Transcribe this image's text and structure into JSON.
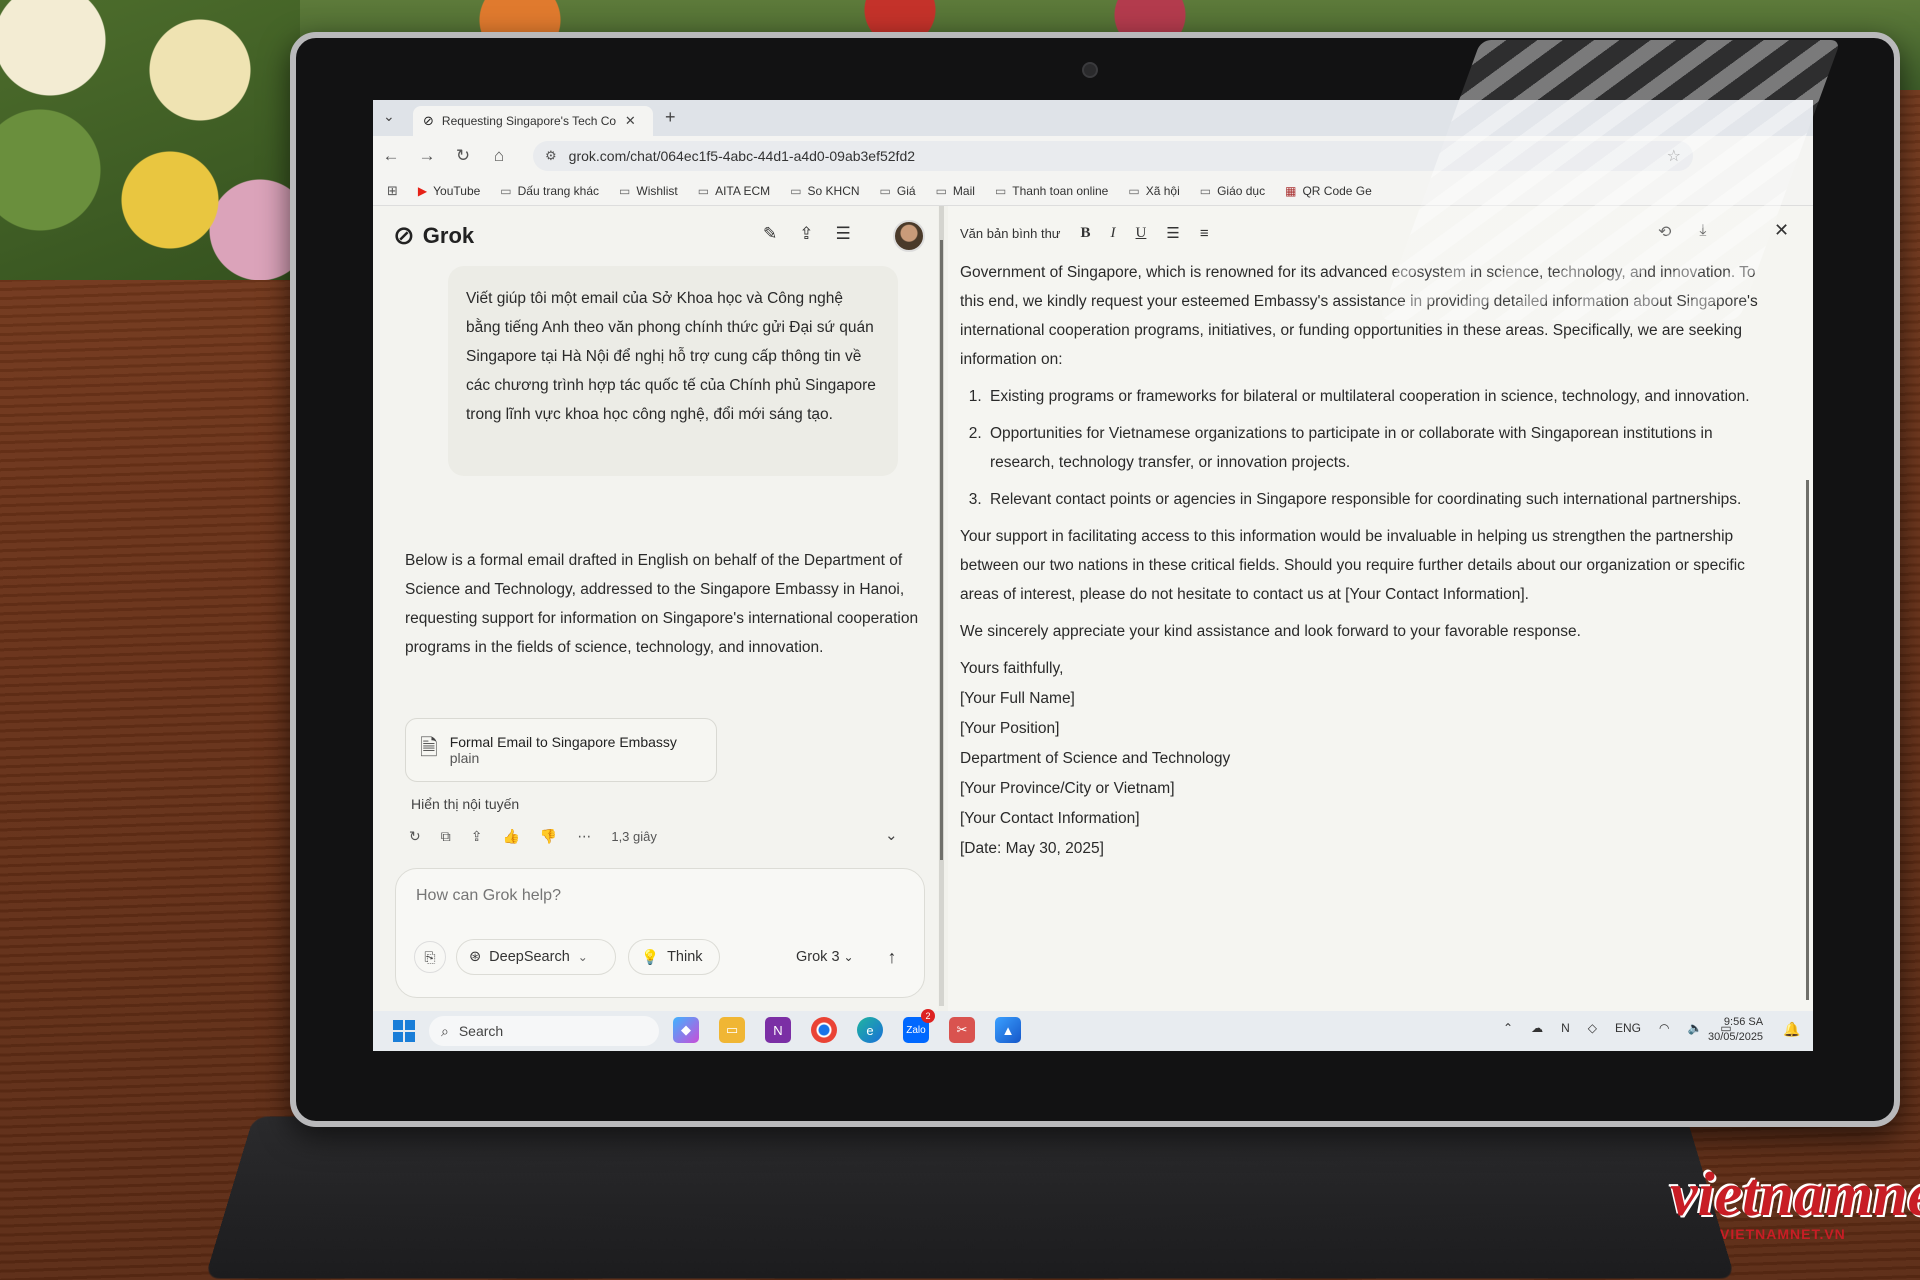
{
  "browser": {
    "tab_title": "Requesting Singapore's Tech Co",
    "url": "grok.com/chat/064ec1f5-4abc-44d1-a4d0-09ab3ef52fd2",
    "bookmarks": [
      "YouTube",
      "Dấu trang khác",
      "Wishlist",
      "AITA ECM",
      "So KHCN",
      "Giá",
      "Mail",
      "Thanh toan online",
      "Xã hội",
      "Giáo dục",
      "QR Code Ge"
    ]
  },
  "grok": {
    "brand": "Grok",
    "user_message": "Viết giúp tôi một email của Sở Khoa học và Công nghệ bằng tiếng Anh theo văn phong chính thức gửi Đại sứ quán Singapore tại Hà Nội để nghị hỗ trợ cung cấp thông tin về các chương trình hợp tác quốc tế của Chính phủ Singapore trong lĩnh vực khoa học công nghệ, đổi mới sáng tạo.",
    "assistant_message": "Below is a formal email drafted in English on behalf of the Department of Science and Technology, addressed to the Singapore Embassy in Hanoi, requesting support for information on Singapore's international cooperation programs in the fields of science, technology, and innovation.",
    "artifact_title": "Formal Email to Singapore Embassy",
    "artifact_type": "plain",
    "show_inline": "Hiển thị nội tuyến",
    "response_time": "1,3 giây",
    "composer_placeholder": "How can Grok help?",
    "deepsearch_label": "DeepSearch",
    "think_label": "Think",
    "model_label": "Grok 3"
  },
  "editor": {
    "format_label": "Văn bản bình thư",
    "paragraph1": "Government of Singapore, which is renowned for its advanced ecosystem in science, technology, and innovation. To this end, we kindly request your esteemed Embassy's assistance in providing detailed information about Singapore's international cooperation programs, initiatives, or funding opportunities in these areas. Specifically, we are seeking information on:",
    "list": [
      "Existing programs or frameworks for bilateral or multilateral cooperation in science, technology, and innovation.",
      "Opportunities for Vietnamese organizations to participate in or collaborate with Singaporean institutions in research, technology transfer, or innovation projects.",
      "Relevant contact points or agencies in Singapore responsible for coordinating such international partnerships."
    ],
    "paragraph2": "Your support in facilitating access to this information would be invaluable in helping us strengthen the partnership between our two nations in these critical fields. Should you require further details about our organization or specific areas of interest, please do not hesitate to contact us at [Your Contact Information].",
    "paragraph3": "We sincerely appreciate your kind assistance and look forward to your favorable response.",
    "signature": [
      "Yours faithfully,",
      "[Your Full Name]",
      "[Your Position]",
      "Department of Science and Technology",
      "[Your Province/City or Vietnam]",
      "[Your Contact Information]",
      "[Date: May 30, 2025]"
    ]
  },
  "taskbar": {
    "search_label": "Search",
    "lang": "ENG",
    "time": "9:56 SA",
    "date": "30/05/2025",
    "zalo_badge": "2"
  },
  "watermark": {
    "logo_text": "vietnamnet",
    "domain": "VIETNAMNET.VN"
  }
}
